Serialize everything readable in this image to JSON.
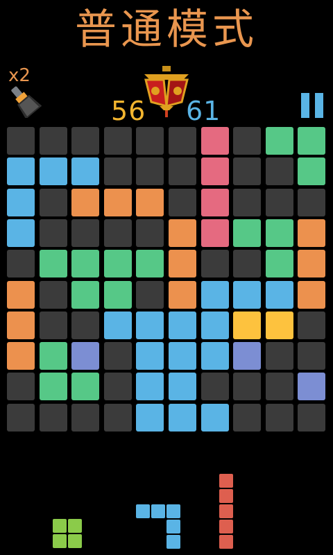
{
  "title": "普通模式",
  "brush": {
    "count_label": "x2",
    "icon": "brush-icon"
  },
  "score": {
    "current": "56",
    "best": "61"
  },
  "icons": {
    "trophy": "lantern-icon",
    "pause": "pause-icon"
  },
  "colors": {
    "empty": "#3b3b3b",
    "blue": "#5ab4e5",
    "orange": "#ec914e",
    "green": "#56c887",
    "pink": "#e56a80",
    "yellow": "#fdc23e",
    "purple": "#7c8ed3",
    "lime": "#8bcb4a",
    "red": "#de5f4f",
    "accent": "#e9964f"
  },
  "board": [
    [
      "E",
      "E",
      "E",
      "E",
      "E",
      "E",
      "P",
      "E",
      "G",
      "G"
    ],
    [
      "B",
      "B",
      "B",
      "E",
      "E",
      "E",
      "P",
      "E",
      "E",
      "G"
    ],
    [
      "B",
      "E",
      "O",
      "O",
      "O",
      "E",
      "P",
      "E",
      "E",
      "E"
    ],
    [
      "B",
      "E",
      "E",
      "E",
      "E",
      "O",
      "P",
      "G",
      "G",
      "O"
    ],
    [
      "E",
      "G",
      "G",
      "G",
      "G",
      "O",
      "E",
      "E",
      "G",
      "O"
    ],
    [
      "O",
      "E",
      "G",
      "G",
      "E",
      "O",
      "B",
      "B",
      "B",
      "O"
    ],
    [
      "O",
      "E",
      "E",
      "B",
      "B",
      "B",
      "B",
      "Y",
      "Y",
      "E"
    ],
    [
      "O",
      "G",
      "V",
      "E",
      "B",
      "B",
      "B",
      "V",
      "E",
      "E"
    ],
    [
      "E",
      "G",
      "G",
      "E",
      "B",
      "B",
      "E",
      "E",
      "E",
      "V"
    ],
    [
      "E",
      "E",
      "E",
      "E",
      "B",
      "B",
      "B",
      "E",
      "E",
      "E"
    ]
  ],
  "pieces": [
    {
      "name": "square-2x2",
      "color": "lime",
      "cells": [
        [
          0,
          0
        ],
        [
          0,
          1
        ],
        [
          1,
          0
        ],
        [
          1,
          1
        ]
      ]
    },
    {
      "name": "hook-piece",
      "color": "blue",
      "cells": [
        [
          0,
          0
        ],
        [
          0,
          1
        ],
        [
          0,
          2
        ],
        [
          1,
          2
        ],
        [
          2,
          2
        ]
      ]
    },
    {
      "name": "line-5",
      "color": "red",
      "cells": [
        [
          0,
          0
        ],
        [
          1,
          0
        ],
        [
          2,
          0
        ],
        [
          3,
          0
        ],
        [
          4,
          0
        ]
      ]
    }
  ]
}
